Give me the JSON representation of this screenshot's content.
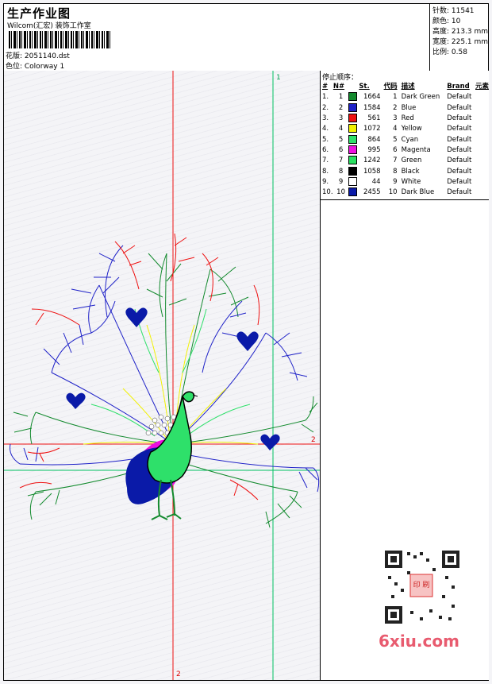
{
  "header": {
    "title": "生产作业图",
    "studio": "Wilcom(汇宏) 装饰工作室",
    "design_file": "花版: 2051140.dst",
    "colorway": "色位: Colorway 1"
  },
  "stats": {
    "stitches": "针数: 11541",
    "colors": "颜色: 10",
    "height": "高度: 213.3 mm",
    "width": "宽度: 225.1 mm",
    "scale": "比例: 0.58"
  },
  "color_panel": {
    "stop_sequence_label": "停止顺序：",
    "headers": {
      "idx": "#",
      "no": "N#",
      "st": "St.",
      "code": "代码",
      "desc": "描述",
      "brand": "Brand",
      "element": "元素"
    },
    "rows": [
      {
        "idx": "1.",
        "no": "1",
        "color": "#138a2e",
        "st": "1664",
        "code": "1",
        "desc": "Dark Green",
        "brand": "Default"
      },
      {
        "idx": "2.",
        "no": "2",
        "color": "#1f22c8",
        "st": "1584",
        "code": "2",
        "desc": "Blue",
        "brand": "Default"
      },
      {
        "idx": "3.",
        "no": "3",
        "color": "#ee1111",
        "st": "561",
        "code": "3",
        "desc": "Red",
        "brand": "Default"
      },
      {
        "idx": "4.",
        "no": "4",
        "color": "#f2f200",
        "st": "1072",
        "code": "4",
        "desc": "Yellow",
        "brand": "Default"
      },
      {
        "idx": "5.",
        "no": "5",
        "color": "#2ee06a",
        "st": "864",
        "code": "5",
        "desc": "Cyan",
        "brand": "Default"
      },
      {
        "idx": "6.",
        "no": "6",
        "color": "#ee10e0",
        "st": "995",
        "code": "6",
        "desc": "Magenta",
        "brand": "Default"
      },
      {
        "idx": "7.",
        "no": "7",
        "color": "#28e060",
        "st": "1242",
        "code": "7",
        "desc": "Green",
        "brand": "Default"
      },
      {
        "idx": "8.",
        "no": "8",
        "color": "#000000",
        "st": "1058",
        "code": "8",
        "desc": "Black",
        "brand": "Default"
      },
      {
        "idx": "9.",
        "no": "9",
        "color": "#ffffff",
        "st": "44",
        "code": "9",
        "desc": "White",
        "brand": "Default"
      },
      {
        "idx": "10.",
        "no": "10",
        "color": "#0a1aa8",
        "st": "2455",
        "code": "10",
        "desc": "Dark Blue",
        "brand": "Default"
      }
    ]
  },
  "axes": {
    "green_vertical_label": "1",
    "red_horizontal_label": "2",
    "red_vertical_label": "2"
  },
  "watermark": "6xiu.com",
  "qr_stamp_text": "印 刷"
}
